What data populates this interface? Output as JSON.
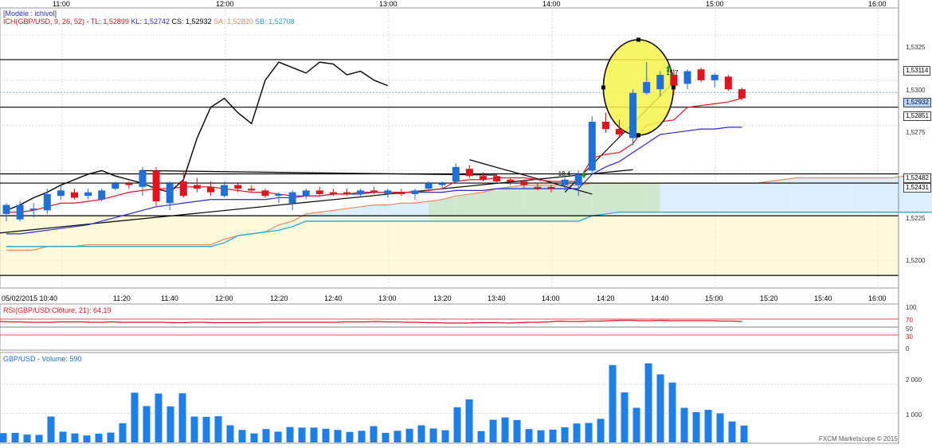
{
  "colors": {
    "bull": "#1f6fd6",
    "bear": "#e0141e",
    "tenkan": "#e0141e",
    "kijun": "#2a2ad0",
    "ssa": "#f08a5a",
    "ssb": "#1aa0d8",
    "chikou": "#000000",
    "cloud_bull": "#fbf6c4",
    "cloud_bear": "#dcefff",
    "cloud_mid": "#cfe6cf",
    "rsi": "#e0141e",
    "volume": "#1f7fe8",
    "highlight": "#f6f24a",
    "grid": "#d8d8d8",
    "axis_text": "#333333"
  },
  "header": {
    "model_label": "[Modèle : ichivol]",
    "ich_label": "ICH(GBP/USD, 9, 26, 52) -",
    "tl_label": "TL: 1,52899",
    "kl_label": "KL: 1,52742",
    "cs_label": "CS: 1,52932",
    "sa_label": "SA: 1,52820",
    "sb_label": "SB: 1,52708"
  },
  "top_axis": {
    "labels": [
      "11:00",
      "12:00",
      "13:00",
      "14:00",
      "15:00",
      "16:00"
    ]
  },
  "bottom_axis": {
    "labels": [
      "05/02/2015 10:40",
      "11:20",
      "11:40",
      "12:00",
      "12:20",
      "12:40",
      "13:00",
      "13:20",
      "13:40",
      "14:00",
      "14:20",
      "14:40",
      "15:00",
      "15:20",
      "15:40",
      "16:00"
    ]
  },
  "price_axis": {
    "labels": [
      "1,5325",
      "1,5300",
      "1,5275",
      "1,5225",
      "1,5200"
    ]
  },
  "price_badges": {
    "labels": [
      "1,53114",
      "1,52932",
      "1,52851",
      "1,52482",
      "1,52431"
    ]
  },
  "annotations": {
    "a1": "-18.4",
    "a2": "15.7"
  },
  "rsi_panel": {
    "label": "RSI(GBP/USD:Clôture, 21): 64,19",
    "levels": [
      "100",
      "70",
      "50",
      "30",
      "0"
    ]
  },
  "volume_panel": {
    "label": "GBP/USD - Volume: 590",
    "levels": [
      "2 000",
      "1 000"
    ]
  },
  "footer": {
    "brand": "FXCM Marketscope © 2015"
  },
  "chart_data": {
    "type": "candlestick",
    "instrument": "GBP/USD",
    "date": "05/02/2015",
    "interval": "5min",
    "price_range": [
      1.5185,
      1.534
    ],
    "candles": [
      {
        "t": "10:40",
        "o": 1.5226,
        "h": 1.5232,
        "l": 1.5222,
        "c": 1.5231
      },
      {
        "t": "10:45",
        "o": 1.5223,
        "h": 1.5233,
        "l": 1.5222,
        "c": 1.5231
      },
      {
        "t": "10:50",
        "o": 1.5228,
        "h": 1.5232,
        "l": 1.5224,
        "c": 1.5229
      },
      {
        "t": "10:55",
        "o": 1.5228,
        "h": 1.524,
        "l": 1.5226,
        "c": 1.5237
      },
      {
        "t": "11:00",
        "o": 1.5236,
        "h": 1.5242,
        "l": 1.5234,
        "c": 1.5239
      },
      {
        "t": "11:05",
        "o": 1.5238,
        "h": 1.524,
        "l": 1.5234,
        "c": 1.5235
      },
      {
        "t": "11:10",
        "o": 1.5236,
        "h": 1.524,
        "l": 1.5234,
        "c": 1.5238
      },
      {
        "t": "11:15",
        "o": 1.5234,
        "h": 1.524,
        "l": 1.5233,
        "c": 1.5239
      },
      {
        "t": "11:20",
        "o": 1.524,
        "h": 1.5244,
        "l": 1.5239,
        "c": 1.5243
      },
      {
        "t": "11:25",
        "o": 1.5243,
        "h": 1.5244,
        "l": 1.524,
        "c": 1.5242
      },
      {
        "t": "11:30",
        "o": 1.5241,
        "h": 1.5252,
        "l": 1.5236,
        "c": 1.525
      },
      {
        "t": "11:35",
        "o": 1.525,
        "h": 1.5252,
        "l": 1.523,
        "c": 1.5233
      },
      {
        "t": "11:40",
        "o": 1.5232,
        "h": 1.5244,
        "l": 1.5228,
        "c": 1.5243
      },
      {
        "t": "11:45",
        "o": 1.5244,
        "h": 1.525,
        "l": 1.5235,
        "c": 1.5236
      },
      {
        "t": "11:50",
        "o": 1.5242,
        "h": 1.5246,
        "l": 1.5238,
        "c": 1.524
      },
      {
        "t": "11:55",
        "o": 1.5241,
        "h": 1.5244,
        "l": 1.5236,
        "c": 1.5238
      },
      {
        "t": "12:00",
        "o": 1.5236,
        "h": 1.5244,
        "l": 1.5235,
        "c": 1.5242
      },
      {
        "t": "12:05",
        "o": 1.5242,
        "h": 1.5243,
        "l": 1.5238,
        "c": 1.524
      },
      {
        "t": "12:10",
        "o": 1.524,
        "h": 1.5242,
        "l": 1.5238,
        "c": 1.5239
      },
      {
        "t": "12:15",
        "o": 1.5239,
        "h": 1.524,
        "l": 1.5235,
        "c": 1.5236
      },
      {
        "t": "12:20",
        "o": 1.5236,
        "h": 1.5238,
        "l": 1.5232,
        "c": 1.5237
      },
      {
        "t": "12:25",
        "o": 1.5232,
        "h": 1.5239,
        "l": 1.5228,
        "c": 1.5238
      },
      {
        "t": "12:30",
        "o": 1.5236,
        "h": 1.524,
        "l": 1.5234,
        "c": 1.5239
      },
      {
        "t": "12:35",
        "o": 1.5239,
        "h": 1.5241,
        "l": 1.5236,
        "c": 1.5237
      },
      {
        "t": "12:40",
        "o": 1.5238,
        "h": 1.524,
        "l": 1.5236,
        "c": 1.5237
      },
      {
        "t": "12:45",
        "o": 1.5238,
        "h": 1.524,
        "l": 1.5236,
        "c": 1.5237
      },
      {
        "t": "12:50",
        "o": 1.5237,
        "h": 1.524,
        "l": 1.5236,
        "c": 1.5239
      },
      {
        "t": "12:55",
        "o": 1.5239,
        "h": 1.5241,
        "l": 1.5237,
        "c": 1.5238
      },
      {
        "t": "13:00",
        "o": 1.5237,
        "h": 1.524,
        "l": 1.5235,
        "c": 1.5239
      },
      {
        "t": "13:05",
        "o": 1.5238,
        "h": 1.524,
        "l": 1.5236,
        "c": 1.5237
      },
      {
        "t": "13:10",
        "o": 1.5237,
        "h": 1.524,
        "l": 1.5234,
        "c": 1.5239
      },
      {
        "t": "13:15",
        "o": 1.524,
        "h": 1.5244,
        "l": 1.5238,
        "c": 1.5243
      },
      {
        "t": "13:20",
        "o": 1.5242,
        "h": 1.5244,
        "l": 1.524,
        "c": 1.5243
      },
      {
        "t": "13:25",
        "o": 1.5244,
        "h": 1.5254,
        "l": 1.5243,
        "c": 1.5252
      },
      {
        "t": "13:30",
        "o": 1.5251,
        "h": 1.5253,
        "l": 1.5246,
        "c": 1.5247
      },
      {
        "t": "13:35",
        "o": 1.5247,
        "h": 1.5249,
        "l": 1.5244,
        "c": 1.5245
      },
      {
        "t": "13:40",
        "o": 1.5247,
        "h": 1.5248,
        "l": 1.5243,
        "c": 1.5244
      },
      {
        "t": "13:45",
        "o": 1.5245,
        "h": 1.5246,
        "l": 1.5242,
        "c": 1.5244
      },
      {
        "t": "13:50",
        "o": 1.5244,
        "h": 1.5245,
        "l": 1.524,
        "c": 1.5242
      },
      {
        "t": "13:55",
        "o": 1.5241,
        "h": 1.5243,
        "l": 1.5239,
        "c": 1.524
      },
      {
        "t": "14:00",
        "o": 1.5241,
        "h": 1.5242,
        "l": 1.5238,
        "c": 1.524
      },
      {
        "t": "14:05",
        "o": 1.5242,
        "h": 1.5246,
        "l": 1.5239,
        "c": 1.5245
      },
      {
        "t": "14:10",
        "o": 1.5242,
        "h": 1.525,
        "l": 1.5236,
        "c": 1.5248
      },
      {
        "t": "14:15",
        "o": 1.525,
        "h": 1.528,
        "l": 1.5248,
        "c": 1.5277
      },
      {
        "t": "14:20",
        "o": 1.5277,
        "h": 1.5282,
        "l": 1.5271,
        "c": 1.5273
      },
      {
        "t": "14:25",
        "o": 1.5273,
        "h": 1.5278,
        "l": 1.5268,
        "c": 1.527
      },
      {
        "t": "14:30",
        "o": 1.5268,
        "h": 1.5295,
        "l": 1.5264,
        "c": 1.5293
      },
      {
        "t": "14:35",
        "o": 1.5293,
        "h": 1.531,
        "l": 1.5292,
        "c": 1.5299
      },
      {
        "t": "14:40",
        "o": 1.5295,
        "h": 1.5305,
        "l": 1.5291,
        "c": 1.5303
      },
      {
        "t": "14:45",
        "o": 1.5303,
        "h": 1.5306,
        "l": 1.5292,
        "c": 1.5297
      },
      {
        "t": "14:50",
        "o": 1.5298,
        "h": 1.5306,
        "l": 1.5295,
        "c": 1.5305
      },
      {
        "t": "14:55",
        "o": 1.5306,
        "h": 1.5307,
        "l": 1.5299,
        "c": 1.53
      },
      {
        "t": "15:00",
        "o": 1.53,
        "h": 1.5304,
        "l": 1.5296,
        "c": 1.5303
      },
      {
        "t": "15:05",
        "o": 1.5302,
        "h": 1.5303,
        "l": 1.5294,
        "c": 1.5295
      },
      {
        "t": "15:10",
        "o": 1.5295,
        "h": 1.5296,
        "l": 1.5289,
        "c": 1.529
      }
    ],
    "horizontal_levels": [
      1.53114,
      1.52851,
      1.52482,
      1.52431,
      1.5225,
      1.5192
    ],
    "current_price": 1.52932,
    "ichimoku": {
      "tenkan_last": 1.52899,
      "kijun_last": 1.52742,
      "chikou_last": 1.52932,
      "senkou_a_last": 1.5282,
      "senkou_b_last": 1.52708,
      "senkou_a": [
        1.5206,
        1.5206,
        1.5206,
        1.5208,
        1.5208,
        1.5208,
        1.5209,
        1.5209,
        1.5209,
        1.5209,
        1.5209,
        1.5209,
        1.5209,
        1.5209,
        1.5209,
        1.5209,
        1.5212,
        1.5214,
        1.5215,
        1.5216,
        1.522,
        1.5222,
        1.5226,
        1.5227,
        1.5228,
        1.5229,
        1.523,
        1.5231,
        1.5231,
        1.5232,
        1.5232,
        1.5233,
        1.5234,
        1.5236,
        1.5237,
        1.5238,
        1.524,
        1.5241,
        1.5242,
        1.5242,
        1.5242,
        1.5242,
        1.5242,
        1.5243,
        1.5243,
        1.5243,
        1.5243,
        1.5243,
        1.5243,
        1.5243,
        1.5243,
        1.5243,
        1.5243,
        1.5243,
        1.5243,
        1.5243,
        1.5244,
        1.5245,
        1.5246,
        1.5246,
        1.5246,
        1.5246,
        1.5246,
        1.5246,
        1.5246,
        1.5246,
        1.5247,
        1.5248,
        1.5248,
        1.5248,
        1.5248,
        1.5248,
        1.5248,
        1.5248,
        1.5248,
        1.5248,
        1.5248,
        1.5249,
        1.525,
        1.525
      ],
      "senkou_b": [
        1.5208,
        1.5208,
        1.5208,
        1.5208,
        1.5208,
        1.5208,
        1.5208,
        1.5208,
        1.5208,
        1.5208,
        1.5208,
        1.5208,
        1.5208,
        1.5208,
        1.5208,
        1.5208,
        1.521,
        1.5214,
        1.5215,
        1.5216,
        1.5217,
        1.5219,
        1.5222,
        1.5222,
        1.5222,
        1.5222,
        1.5222,
        1.5222,
        1.5222,
        1.5222,
        1.5222,
        1.5222,
        1.5222,
        1.5222,
        1.5222,
        1.5222,
        1.5222,
        1.5222,
        1.5222,
        1.5222,
        1.5222,
        1.5222,
        1.5222,
        1.5225,
        1.5226,
        1.5227,
        1.5227,
        1.5227,
        1.5227,
        1.5227,
        1.5227,
        1.5227,
        1.5227,
        1.5227,
        1.5227,
        1.5227,
        1.5227,
        1.5227,
        1.5227,
        1.5227,
        1.5227,
        1.5227,
        1.5227,
        1.5227,
        1.5227,
        1.5227,
        1.5227,
        1.5227,
        1.5227,
        1.5227,
        1.5227,
        1.5227,
        1.5227,
        1.5227,
        1.5227,
        1.5228,
        1.5228,
        1.5228,
        1.5228,
        1.5228
      ],
      "tenkan": [
        1.5227,
        1.5227,
        1.5228,
        1.523,
        1.5232,
        1.5232,
        1.5233,
        1.5234,
        1.5236,
        1.5238,
        1.5239,
        1.524,
        1.524,
        1.5241,
        1.5241,
        1.5241,
        1.524,
        1.5239,
        1.5238,
        1.5238,
        1.5237,
        1.5236,
        1.5236,
        1.5236,
        1.5237,
        1.5237,
        1.5238,
        1.5238,
        1.5238,
        1.5238,
        1.5238,
        1.5239,
        1.524,
        1.5244,
        1.5245,
        1.5245,
        1.5246,
        1.5246,
        1.5246,
        1.5245,
        1.5244,
        1.5244,
        1.5244,
        1.5257,
        1.5259,
        1.526,
        1.5265,
        1.5275,
        1.5277,
        1.5278,
        1.5285,
        1.5286,
        1.5287,
        1.5288,
        1.529
      ],
      "kijun": [
        1.5215,
        1.5215,
        1.5216,
        1.5217,
        1.5218,
        1.5219,
        1.522,
        1.5222,
        1.5224,
        1.5226,
        1.5228,
        1.523,
        1.5231,
        1.5232,
        1.5233,
        1.5234,
        1.5234,
        1.5234,
        1.5234,
        1.5234,
        1.5235,
        1.5235,
        1.5236,
        1.5236,
        1.5237,
        1.5237,
        1.5237,
        1.5238,
        1.5238,
        1.5238,
        1.5238,
        1.5238,
        1.5238,
        1.5239,
        1.5239,
        1.5239,
        1.524,
        1.524,
        1.524,
        1.524,
        1.524,
        1.524,
        1.524,
        1.5248,
        1.5252,
        1.5255,
        1.526,
        1.5265,
        1.527,
        1.5271,
        1.5272,
        1.5273,
        1.5273,
        1.5274,
        1.5274
      ],
      "chikou": [
        1.5228,
        1.5231,
        1.5235,
        1.5238,
        1.5242,
        1.5245,
        1.5248,
        1.525,
        1.5247,
        1.5245,
        1.5243,
        1.524,
        1.5238,
        1.5245,
        1.5268,
        1.5285,
        1.529,
        1.5282,
        1.5276,
        1.53,
        1.531,
        1.5307,
        1.5304,
        1.531,
        1.5309,
        1.5303,
        1.5305,
        1.53,
        1.5297
      ]
    },
    "rsi": {
      "period": 21,
      "last": 64.19,
      "levels": [
        70,
        50,
        30
      ],
      "values": [
        64,
        63,
        63,
        62,
        62,
        62,
        63,
        63,
        63,
        62,
        62,
        63,
        62,
        62,
        62,
        62,
        62,
        61,
        61,
        62,
        62,
        61,
        61,
        61,
        61,
        61,
        62,
        62,
        62,
        62,
        62,
        62,
        62,
        62,
        63,
        63,
        63,
        64,
        63,
        63,
        62,
        62,
        61,
        61,
        60,
        60,
        60,
        61,
        61,
        61,
        60,
        61,
        62,
        62,
        63,
        65,
        64,
        64,
        65,
        65,
        66,
        67,
        67,
        66,
        66,
        67,
        66,
        66,
        66,
        66,
        66,
        65,
        65,
        64
      ]
    },
    "volume": {
      "last": 590,
      "values": [
        320,
        330,
        270,
        260,
        890,
        370,
        310,
        240,
        300,
        340,
        660,
        1710,
        1250,
        1680,
        1240,
        1690,
        890,
        880,
        900,
        590,
        430,
        310,
        460,
        370,
        530,
        510,
        510,
        470,
        430,
        360,
        400,
        560,
        330,
        400,
        470,
        590,
        480,
        420,
        1210,
        1480,
        390,
        780,
        860,
        770,
        460,
        420,
        440,
        520,
        650,
        670,
        810,
        2660,
        1720,
        1190,
        2720,
        2340,
        2060,
        1190,
        1040,
        1120,
        1000,
        720,
        580,
        590,
        590,
        590,
        600,
        460,
        590,
        590,
        590,
        590,
        590,
        590
      ]
    }
  }
}
